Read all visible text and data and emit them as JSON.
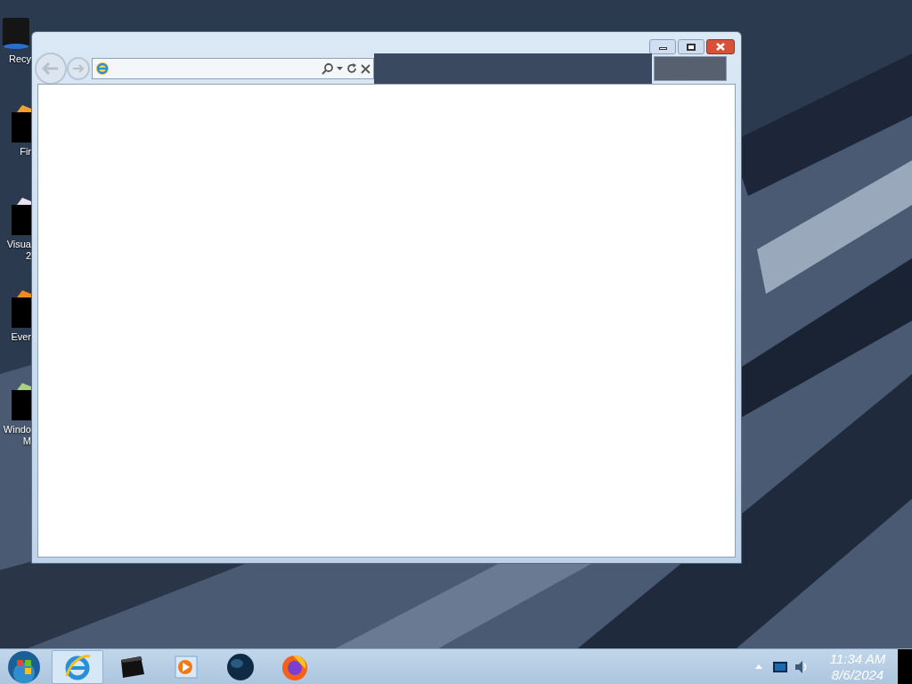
{
  "desktop_icons": [
    {
      "lines": [
        "Recy"
      ],
      "kind": "bin"
    },
    {
      "lines": [
        "Fir"
      ],
      "kind": "thumb",
      "color": "#f0a030"
    },
    {
      "lines": [
        "Visua",
        "2"
      ],
      "kind": "thumb",
      "color": "#e8e0f0"
    },
    {
      "lines": [
        "Ever"
      ],
      "kind": "thumb",
      "color": "#f08a20"
    },
    {
      "lines": [
        "Windo",
        "M"
      ],
      "kind": "thumb",
      "color": "#a8d080"
    }
  ],
  "taskbar": {
    "items": [
      {
        "kind": "ie",
        "selected": true
      },
      {
        "kind": "box",
        "selected": false
      },
      {
        "kind": "media",
        "selected": false
      },
      {
        "kind": "globe",
        "selected": false
      },
      {
        "kind": "firefox",
        "selected": false
      }
    ],
    "clock": {
      "time": "11:34 AM",
      "date": "8/6/2024"
    }
  }
}
